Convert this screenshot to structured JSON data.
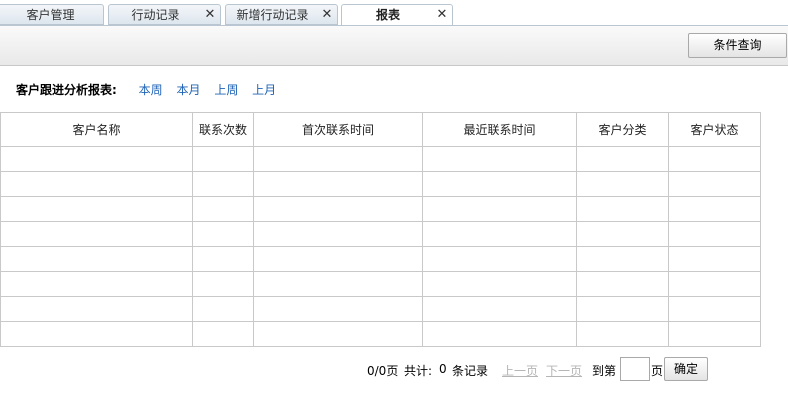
{
  "tabs": [
    {
      "label": "客户管理",
      "closable": false,
      "active": false
    },
    {
      "label": "行动记录",
      "closable": true,
      "active": false
    },
    {
      "label": "新增行动记录",
      "closable": true,
      "active": false
    },
    {
      "label": "报表",
      "closable": true,
      "active": true
    }
  ],
  "icons": {
    "close": "close-icon"
  },
  "close_glyph": "✕",
  "toolbar": {
    "search_button_label": "条件查询"
  },
  "filter": {
    "title": "客户跟进分析报表:",
    "links": [
      "本周",
      "本月",
      "上周",
      "上月"
    ]
  },
  "table": {
    "columns": [
      "客户名称",
      "联系次数",
      "首次联系时间",
      "最近联系时间",
      "客户分类",
      "客户状态"
    ],
    "empty_row_count": 8
  },
  "pager": {
    "page_info": "0/0页",
    "total_label": "共计:",
    "total_count": "0",
    "records_label": "条记录",
    "prev_label": "上一页",
    "next_label": "下一页",
    "goto_label": "到第",
    "page_suffix": "页",
    "page_value": "",
    "confirm_label": "确定"
  }
}
